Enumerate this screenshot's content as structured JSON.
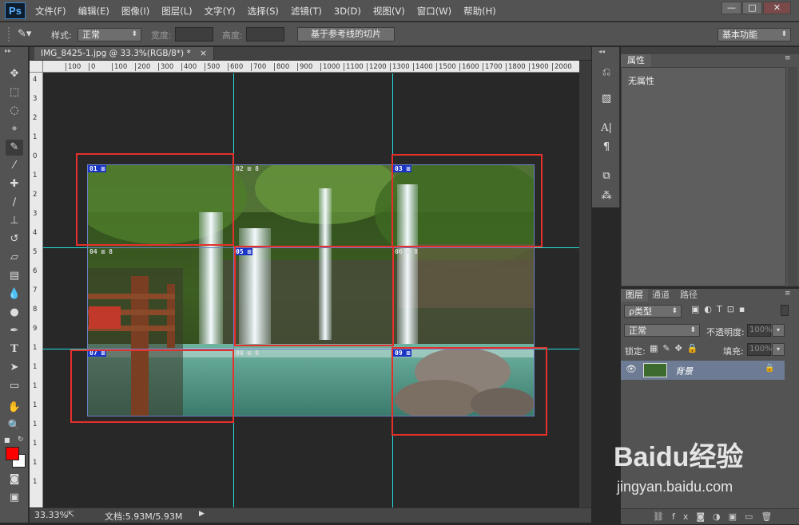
{
  "app": {
    "logo": "Ps"
  },
  "menu": [
    "文件(F)",
    "编辑(E)",
    "图像(I)",
    "图层(L)",
    "文字(Y)",
    "选择(S)",
    "滤镜(T)",
    "3D(D)",
    "视图(V)",
    "窗口(W)",
    "帮助(H)"
  ],
  "window_controls": {
    "minimize": "—",
    "maximize": "□",
    "close": "✕"
  },
  "options": {
    "style_label": "样式:",
    "style_value": "正常",
    "width_label": "宽度:",
    "height_label": "高度:",
    "slice_from_guides": "基于参考线的切片",
    "workspace": "基本功能"
  },
  "document": {
    "tab_title": "IMG_8425-1.jpg @ 33.3%(RGB/8*) *",
    "tab_close": "×",
    "zoom": "33.33%",
    "doc_info": "文档:5.93M/5.93M"
  },
  "ruler": {
    "h_labels": [
      "100",
      "0",
      "100",
      "200",
      "300",
      "400",
      "500",
      "600",
      "700",
      "800",
      "900",
      "1000",
      "1100",
      "1200",
      "1300",
      "1400",
      "1500",
      "1600",
      "1700",
      "1800",
      "1900",
      "2000"
    ],
    "v_labels": [
      "4",
      "3",
      "2",
      "1",
      "0",
      "1",
      "2",
      "3",
      "4",
      "5",
      "6",
      "7",
      "8",
      "9",
      "1",
      "1",
      "1",
      "1",
      "1",
      "1",
      "1",
      "1"
    ]
  },
  "slices": [
    {
      "num": "01",
      "active": true
    },
    {
      "num": "02",
      "active": false
    },
    {
      "num": "03",
      "active": true
    },
    {
      "num": "04",
      "active": false
    },
    {
      "num": "05",
      "active": true
    },
    {
      "num": "06",
      "active": false
    },
    {
      "num": "07",
      "active": true
    },
    {
      "num": "08",
      "active": false
    },
    {
      "num": "09",
      "active": true
    }
  ],
  "tools": [
    "move-tool-icon",
    "marquee-icon",
    "lasso-icon",
    "quick-select-icon",
    "slice-icon",
    "eyedropper-icon",
    "healing-icon",
    "brush-icon",
    "stamp-icon",
    "history-brush-icon",
    "eraser-icon",
    "gradient-icon",
    "blur-icon",
    "dodge-icon",
    "pen-icon",
    "type-icon",
    "path-select-icon",
    "shape-icon",
    "hand-icon",
    "zoom-icon"
  ],
  "colors": {
    "foreground": "#ff0000",
    "background": "#ffffff",
    "guide": "#22e0e0",
    "highlight_box": "#e5302c",
    "slice_tag": "#1a34c6"
  },
  "properties": {
    "tab": "属性",
    "empty": "无属性"
  },
  "layers": {
    "tabs": [
      "图层",
      "通道",
      "路径"
    ],
    "filter": "ρ类型",
    "blend": "正常",
    "opacity_label": "不透明度:",
    "opacity_value": "100%",
    "lock_label": "锁定:",
    "fill_label": "填充:",
    "fill_value": "100%",
    "layer_name": "背景"
  },
  "watermark": {
    "brand": "Baidu经验",
    "url": "jingyan.baidu.com"
  }
}
